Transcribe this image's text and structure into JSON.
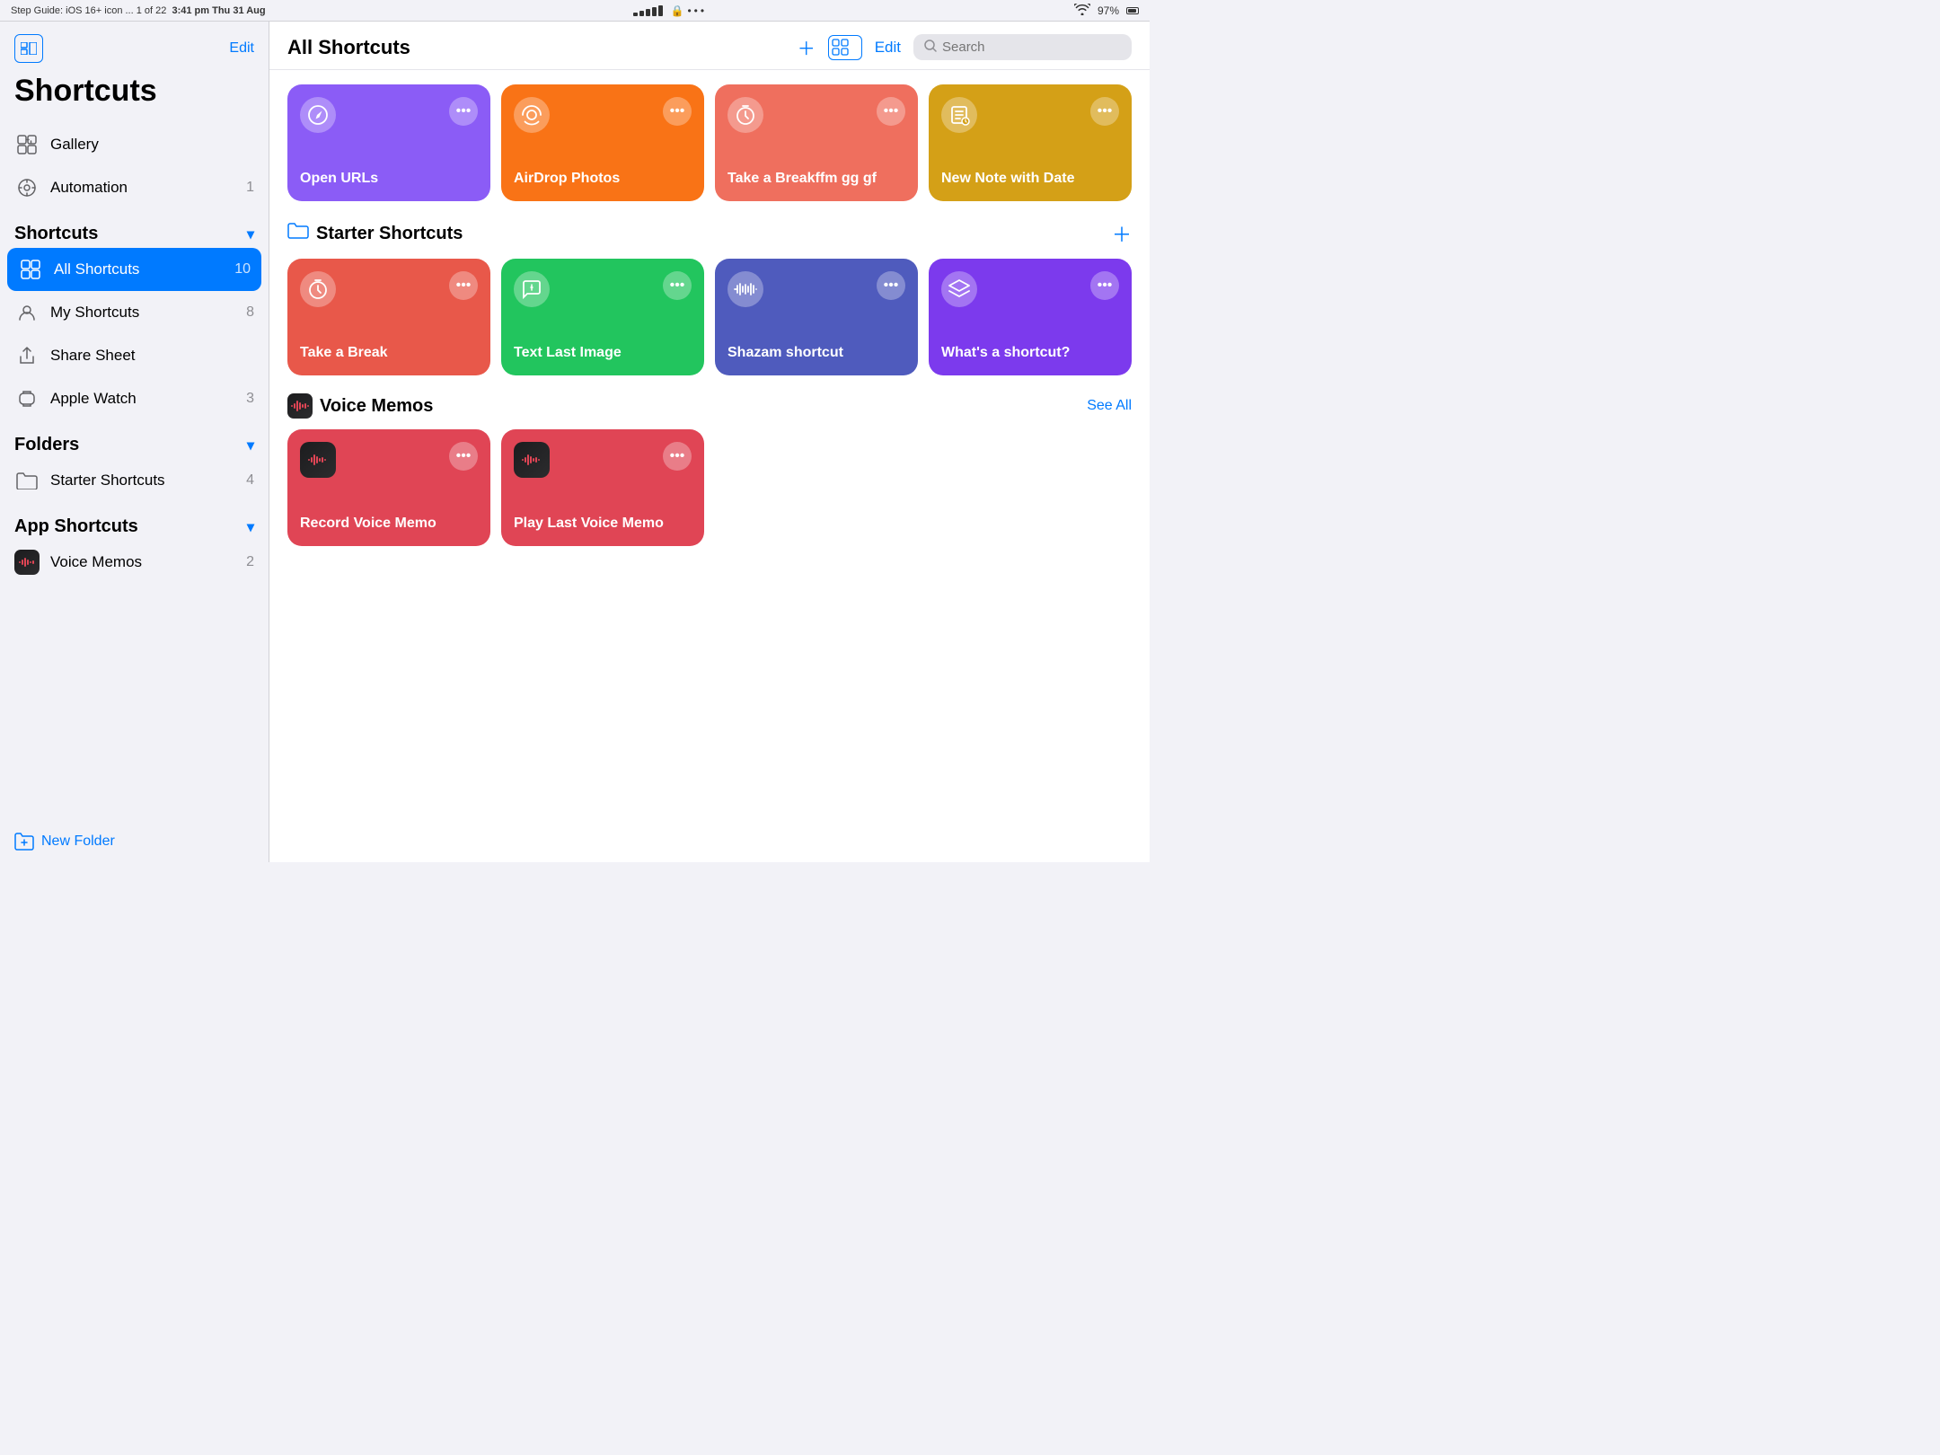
{
  "statusBar": {
    "left": "3:41 pm  Thu 31 Aug",
    "leftSub": "Step Guide: iOS 16+ icon ... 1 of 22",
    "wifi": "97%",
    "lock": "🔒"
  },
  "sidebar": {
    "editLabel": "Edit",
    "title": "Shortcuts",
    "nav": [
      {
        "id": "gallery",
        "label": "Gallery",
        "icon": "⊕",
        "count": ""
      },
      {
        "id": "automation",
        "label": "Automation",
        "icon": "◷",
        "count": "1"
      }
    ],
    "shortcutsSection": {
      "label": "Shortcuts",
      "items": [
        {
          "id": "all-shortcuts",
          "label": "All Shortcuts",
          "count": "10",
          "active": true
        },
        {
          "id": "my-shortcuts",
          "label": "My Shortcuts",
          "count": "8",
          "active": false
        }
      ]
    },
    "otherNav": [
      {
        "id": "share-sheet",
        "label": "Share Sheet",
        "icon": "⬆",
        "count": ""
      },
      {
        "id": "apple-watch",
        "label": "Apple Watch",
        "icon": "⌚",
        "count": "3"
      }
    ],
    "folders": {
      "label": "Folders",
      "items": [
        {
          "id": "starter-shortcuts",
          "label": "Starter Shortcuts",
          "count": "4"
        }
      ]
    },
    "appShortcuts": {
      "label": "App Shortcuts",
      "items": [
        {
          "id": "voice-memos",
          "label": "Voice Memos",
          "count": "2"
        }
      ]
    },
    "newFolderLabel": "New Folder"
  },
  "content": {
    "title": "All Shortcuts",
    "searchPlaceholder": "Search",
    "allShortcutsCards": [
      {
        "id": "open-urls",
        "name": "Open URLs",
        "color": "purple",
        "icon": "compass"
      },
      {
        "id": "airdrop-photos",
        "name": "AirDrop Photos",
        "color": "orange",
        "icon": "airdrop"
      },
      {
        "id": "take-a-break",
        "name": "Take a Breakffm gg gf",
        "color": "salmon",
        "icon": "timer"
      },
      {
        "id": "new-note-with-date",
        "name": "New Note with Date",
        "color": "yellow",
        "icon": "note"
      }
    ],
    "starterShortcutsSection": {
      "label": "Starter Shortcuts",
      "cards": [
        {
          "id": "take-break",
          "name": "Take a Break",
          "color": "coral",
          "icon": "timer"
        },
        {
          "id": "text-last-image",
          "name": "Text Last Image",
          "color": "green",
          "icon": "message"
        },
        {
          "id": "shazam-shortcut",
          "name": "Shazam shortcut",
          "color": "indigo",
          "icon": "waveform"
        },
        {
          "id": "whats-shortcut",
          "name": "What's a shortcut?",
          "color": "grape",
          "icon": "layers"
        }
      ]
    },
    "voiceMemosSection": {
      "label": "Voice Memos",
      "seeAllLabel": "See All",
      "cards": [
        {
          "id": "record-voice-memo",
          "name": "Record Voice Memo",
          "color": "red",
          "icon": "voice"
        },
        {
          "id": "play-last-voice-memo",
          "name": "Play Last Voice Memo",
          "color": "red",
          "icon": "voice2"
        }
      ]
    }
  }
}
